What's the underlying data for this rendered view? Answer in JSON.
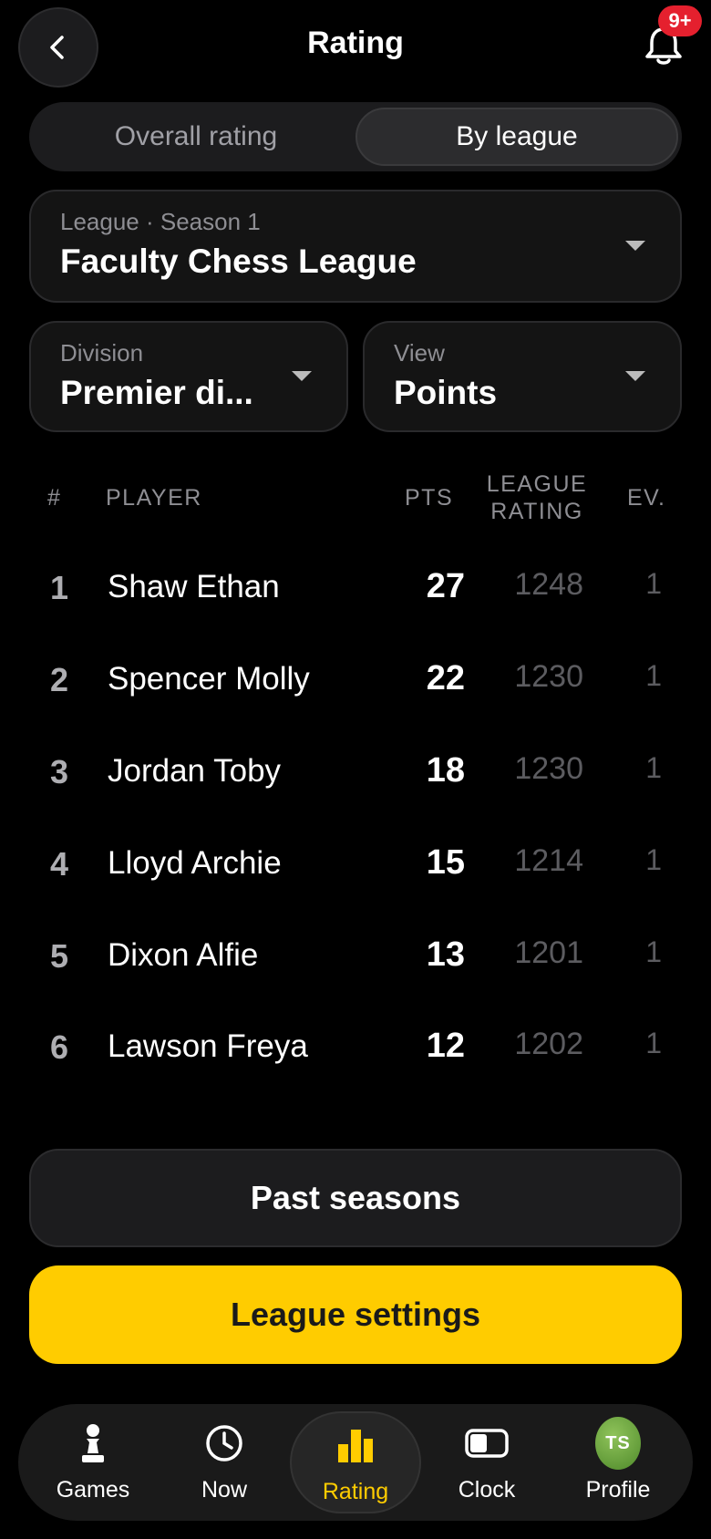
{
  "header": {
    "title": "Rating",
    "badge": "9+"
  },
  "segments": [
    {
      "label": "Overall rating",
      "active": false
    },
    {
      "label": "By league",
      "active": true
    }
  ],
  "filters": {
    "league": {
      "caption": "League · Season 1",
      "value": "Faculty Chess League"
    },
    "division": {
      "caption": "Division",
      "value": "Premier di..."
    },
    "view": {
      "caption": "View",
      "value": "Points"
    }
  },
  "table": {
    "headers": {
      "rank": "#",
      "player": "PLAYER",
      "pts": "PTS",
      "rating_line1": "LEAGUE",
      "rating_line2": "RATING",
      "ev": "EV."
    },
    "rows": [
      {
        "rank": "1",
        "name": "Shaw Ethan",
        "pts": "27",
        "rating": "1248",
        "ev": "1"
      },
      {
        "rank": "2",
        "name": "Spencer Molly",
        "pts": "22",
        "rating": "1230",
        "ev": "1"
      },
      {
        "rank": "3",
        "name": "Jordan Toby",
        "pts": "18",
        "rating": "1230",
        "ev": "1"
      },
      {
        "rank": "4",
        "name": "Lloyd Archie",
        "pts": "15",
        "rating": "1214",
        "ev": "1"
      },
      {
        "rank": "5",
        "name": "Dixon Alfie",
        "pts": "13",
        "rating": "1201",
        "ev": "1"
      },
      {
        "rank": "6",
        "name": "Lawson Freya",
        "pts": "12",
        "rating": "1202",
        "ev": "1"
      }
    ]
  },
  "buttons": {
    "past_seasons": "Past seasons",
    "league_settings": "League settings"
  },
  "tabbar": {
    "items": [
      {
        "label": "Games",
        "icon": "pawn-icon"
      },
      {
        "label": "Now",
        "icon": "clock-icon"
      },
      {
        "label": "Rating",
        "icon": "bar-chart-icon",
        "active": true
      },
      {
        "label": "Clock",
        "icon": "chess-clock-icon"
      },
      {
        "label": "Profile",
        "icon": "avatar",
        "initials": "TS"
      }
    ]
  },
  "colors": {
    "accent": "#ffcc00",
    "badge": "#e5202e",
    "background": "#000000"
  }
}
